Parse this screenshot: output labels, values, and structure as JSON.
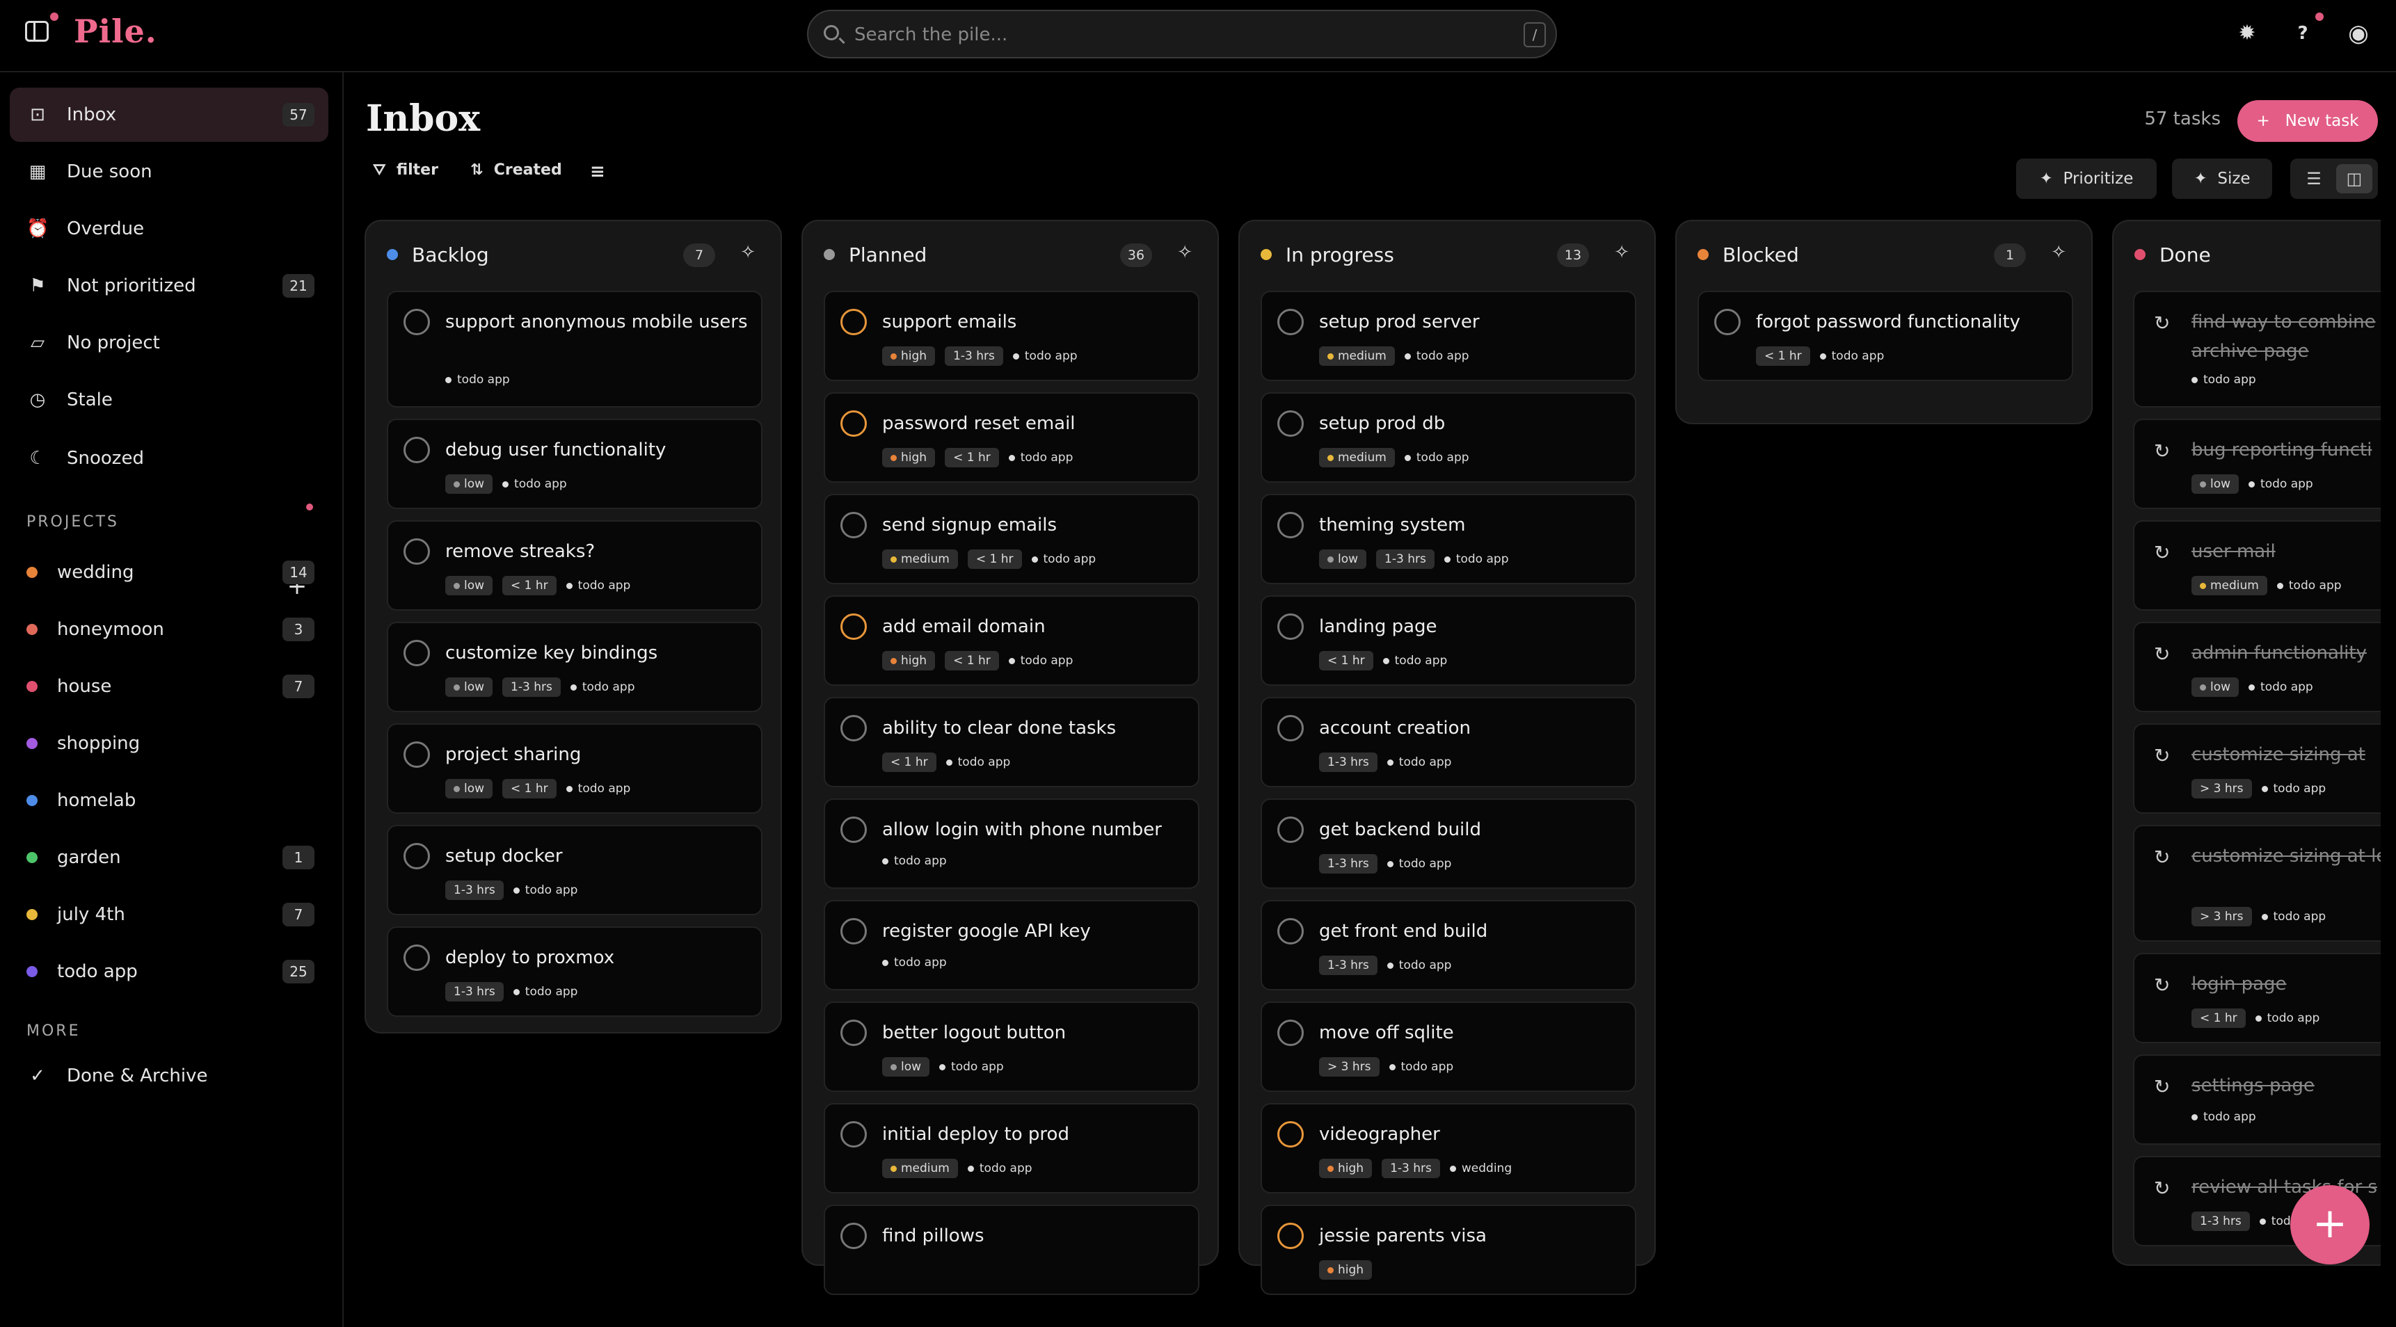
{
  "app": {
    "name": "Pile."
  },
  "search": {
    "placeholder": "Search the pile...",
    "shortcut": "/"
  },
  "topbar": {
    "icons": [
      "sidebar-toggle-icon",
      "bug-icon",
      "help-icon",
      "account-icon"
    ],
    "help_glyph": "?"
  },
  "sidebar": {
    "nav": [
      {
        "id": "inbox",
        "label": "Inbox",
        "count": "57",
        "icon": "inbox-icon",
        "active": true
      },
      {
        "id": "due-soon",
        "label": "Due soon",
        "count": "",
        "icon": "calendar-icon"
      },
      {
        "id": "overdue",
        "label": "Overdue",
        "count": "",
        "icon": "alarm-icon"
      },
      {
        "id": "not-prioritized",
        "label": "Not prioritized",
        "count": "21",
        "icon": "flag-off-icon"
      },
      {
        "id": "no-project",
        "label": "No project",
        "count": "",
        "icon": "folder-off-icon"
      },
      {
        "id": "stale",
        "label": "Stale",
        "count": "",
        "icon": "clock-icon"
      },
      {
        "id": "snoozed",
        "label": "Snoozed",
        "count": "",
        "icon": "moon-icon"
      }
    ],
    "projects_heading": "PROJECTS",
    "projects": [
      {
        "label": "wedding",
        "count": "14",
        "color": "#e8833a"
      },
      {
        "label": "honeymoon",
        "count": "3",
        "color": "#e06a5a"
      },
      {
        "label": "house",
        "count": "7",
        "color": "#e0506e"
      },
      {
        "label": "shopping",
        "count": "",
        "color": "#a35be0"
      },
      {
        "label": "homelab",
        "count": "",
        "color": "#4d8de8"
      },
      {
        "label": "garden",
        "count": "1",
        "color": "#4ec46a"
      },
      {
        "label": "july 4th",
        "count": "7",
        "color": "#e8b83a"
      },
      {
        "label": "todo app",
        "count": "25",
        "color": "#7a5ce8"
      }
    ],
    "more_heading": "MORE",
    "more": [
      {
        "label": "Done & Archive",
        "icon": "check-icon"
      }
    ]
  },
  "main": {
    "title": "Inbox",
    "filter_label": "filter",
    "sort_label": "Created",
    "task_count": "57 tasks",
    "new_task_label": "New task",
    "prioritize_label": "Prioritize",
    "size_label": "Size"
  },
  "colors": {
    "accent": "#e35d86",
    "high": "#e8833a",
    "medium": "#e8b83a",
    "low": "#9a9a9a"
  },
  "columns": [
    {
      "title": "Backlog",
      "count": "7",
      "color": "#4d8de8",
      "tasks": [
        {
          "title": "support anonymous mobile users",
          "priority": "",
          "size": "",
          "project": "todo app"
        },
        {
          "title": "debug user functionality",
          "priority": "low",
          "size": "",
          "project": "todo app"
        },
        {
          "title": "remove streaks?",
          "priority": "low",
          "size": "< 1 hr",
          "project": "todo app"
        },
        {
          "title": "customize key bindings",
          "priority": "low",
          "size": "1-3 hrs",
          "project": "todo app"
        },
        {
          "title": "project sharing",
          "priority": "low",
          "size": "< 1 hr",
          "project": "todo app"
        },
        {
          "title": "setup docker",
          "priority": "",
          "size": "1-3 hrs",
          "project": "todo app"
        },
        {
          "title": "deploy to proxmox",
          "priority": "",
          "size": "1-3 hrs",
          "project": "todo app"
        }
      ]
    },
    {
      "title": "Planned",
      "count": "36",
      "color": "#9a9a9a",
      "tasks": [
        {
          "title": "support emails",
          "priority": "high",
          "size": "1-3 hrs",
          "project": "todo app"
        },
        {
          "title": "password reset email",
          "priority": "high",
          "size": "< 1 hr",
          "project": "todo app"
        },
        {
          "title": "send signup emails",
          "priority": "medium",
          "size": "< 1 hr",
          "project": "todo app"
        },
        {
          "title": "add email domain",
          "priority": "high",
          "size": "< 1 hr",
          "project": "todo app"
        },
        {
          "title": "ability to clear done tasks",
          "priority": "",
          "size": "< 1 hr",
          "project": "todo app"
        },
        {
          "title": "allow login with phone number",
          "priority": "",
          "size": "",
          "project": "todo app"
        },
        {
          "title": "register google API key",
          "priority": "",
          "size": "",
          "project": "todo app"
        },
        {
          "title": "better logout button",
          "priority": "low",
          "size": "",
          "project": "todo app"
        },
        {
          "title": "initial deploy to prod",
          "priority": "medium",
          "size": "",
          "project": "todo app"
        },
        {
          "title": "find pillows",
          "priority": "",
          "size": "",
          "project": ""
        }
      ]
    },
    {
      "title": "In progress",
      "count": "13",
      "color": "#e8b83a",
      "tasks": [
        {
          "title": "setup prod server",
          "priority": "medium",
          "size": "",
          "project": "todo app"
        },
        {
          "title": "setup prod db",
          "priority": "medium",
          "size": "",
          "project": "todo app"
        },
        {
          "title": "theming system",
          "priority": "low",
          "size": "1-3 hrs",
          "project": "todo app"
        },
        {
          "title": "landing page",
          "priority": "",
          "size": "< 1 hr",
          "project": "todo app"
        },
        {
          "title": "account creation",
          "priority": "",
          "size": "1-3 hrs",
          "project": "todo app"
        },
        {
          "title": "get backend build",
          "priority": "",
          "size": "1-3 hrs",
          "project": "todo app"
        },
        {
          "title": "get front end build",
          "priority": "",
          "size": "1-3 hrs",
          "project": "todo app"
        },
        {
          "title": "move off sqlite",
          "priority": "",
          "size": "> 3 hrs",
          "project": "todo app"
        },
        {
          "title": "videographer",
          "priority": "high",
          "size": "1-3 hrs",
          "project": "wedding"
        },
        {
          "title": "jessie parents visa",
          "priority": "high",
          "size": "",
          "project": ""
        }
      ]
    },
    {
      "title": "Blocked",
      "count": "1",
      "color": "#e8833a",
      "tasks": [
        {
          "title": "forgot password functionality",
          "priority": "",
          "size": "< 1 hr",
          "project": "todo app"
        }
      ]
    },
    {
      "title": "Done",
      "count": "",
      "color": "#e0506e",
      "tasks": [
        {
          "title": "find way to combine archive page",
          "priority": "",
          "size": "",
          "project": "todo app"
        },
        {
          "title": "bug reporting functi",
          "priority": "low",
          "size": "",
          "project": "todo app"
        },
        {
          "title": "user mail",
          "priority": "medium",
          "size": "",
          "project": "todo app"
        },
        {
          "title": "admin functionality",
          "priority": "low",
          "size": "",
          "project": "todo app"
        },
        {
          "title": "customize sizing at",
          "priority": "",
          "size": "> 3 hrs",
          "project": "todo app"
        },
        {
          "title": "customize sizing at level",
          "priority": "",
          "size": "> 3 hrs",
          "project": "todo app"
        },
        {
          "title": "login page",
          "priority": "",
          "size": "< 1 hr",
          "project": "todo app"
        },
        {
          "title": "settings page",
          "priority": "",
          "size": "",
          "project": "todo app"
        },
        {
          "title": "review all tasks for s",
          "priority": "",
          "size": "1-3 hrs",
          "project": "todo"
        }
      ]
    }
  ]
}
